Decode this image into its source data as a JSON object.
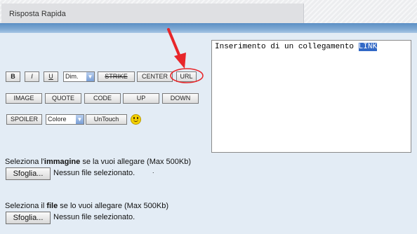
{
  "panel": {
    "title": "Risposta Rapida"
  },
  "toolbar": {
    "row1": {
      "bold": "B",
      "italic": "I",
      "underline": "U",
      "dim_select": "Dim.",
      "strike": "STRIKE",
      "center": "CENTER",
      "url": "URL"
    },
    "row2": {
      "image": "IMAGE",
      "quote": "QUOTE",
      "code": "CODE",
      "up": "UP",
      "down": "DOWN"
    },
    "row3": {
      "spoiler": "SPOILER",
      "color_select": "Colore",
      "untouch": "UnTouch"
    }
  },
  "editor": {
    "text": "Inserimento di un collegamento ",
    "selected_text": "LINK"
  },
  "image_upload": {
    "prefix": "Seleziona l'",
    "bold": "immagine",
    "suffix": " se la vuoi allegare (Max 500Kb)",
    "button": "Sfoglia...",
    "status": "Nessun file selezionato."
  },
  "file_upload": {
    "prefix": "Seleziona il ",
    "bold": "file",
    "suffix": " se lo vuoi allegare (Max 500Kb)",
    "button": "Sfoglia...",
    "status": "Nessun file selezionato."
  },
  "annotation": {
    "color": "#e8262a",
    "highlighted_button": "URL"
  },
  "colors": {
    "panel_bg": "#e3ecf5",
    "blue_bar": "#6b9ccf",
    "selection": "#3168c6"
  }
}
